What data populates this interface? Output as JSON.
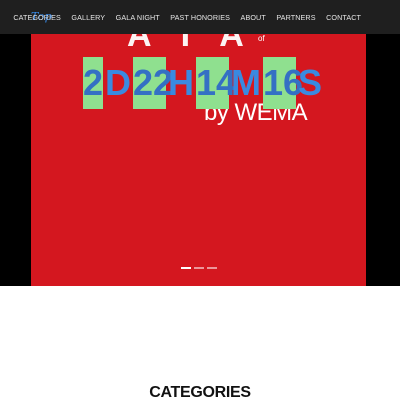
{
  "brand": {
    "logo_text": "Top"
  },
  "nav": {
    "items": [
      "CATEGORIES",
      "GALLERY",
      "GALA NIGHT",
      "PAST HONORIES",
      "ABOUT",
      "PARTNERS",
      "CONTACT"
    ]
  },
  "hero": {
    "title_fragment": "ATA",
    "sup_text": "of",
    "subtitle": "by WEMA",
    "background_color": "#d4171f"
  },
  "countdown": {
    "days": "2",
    "days_unit": "D",
    "hours": "22",
    "hours_unit": "H",
    "minutes": "14",
    "minutes_unit": "M",
    "seconds": "16",
    "seconds_unit": "S",
    "box_color": "#8fe08f",
    "digit_color": "#3470c4"
  },
  "slider": {
    "dot_count": 3,
    "active_index": 0
  },
  "section": {
    "heading": "CATEGORIES"
  }
}
